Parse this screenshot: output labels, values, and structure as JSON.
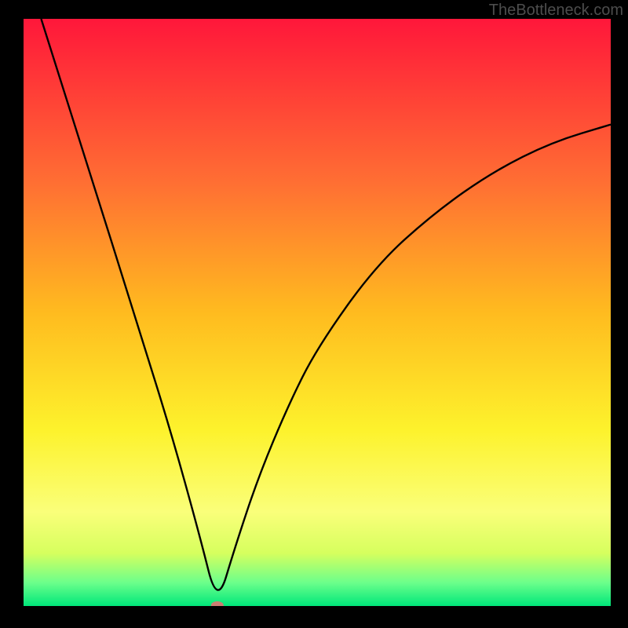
{
  "watermark": "TheBottleneck.com",
  "chart_data": {
    "type": "line",
    "title": "",
    "xlabel": "",
    "ylabel": "",
    "xlim": [
      0,
      100
    ],
    "ylim": [
      0,
      100
    ],
    "grid": false,
    "background_gradient": {
      "stops": [
        {
          "pos": 0,
          "color": "#ff173a"
        },
        {
          "pos": 28,
          "color": "#ff6f33"
        },
        {
          "pos": 50,
          "color": "#ffbb1f"
        },
        {
          "pos": 70,
          "color": "#fdf22c"
        },
        {
          "pos": 84,
          "color": "#faff7a"
        },
        {
          "pos": 91,
          "color": "#d6ff5e"
        },
        {
          "pos": 96,
          "color": "#6cff8b"
        },
        {
          "pos": 100,
          "color": "#00e77a"
        }
      ]
    },
    "curve": {
      "minimum_x": 33,
      "samples": [
        {
          "x": 3,
          "y": 100
        },
        {
          "x": 10,
          "y": 78
        },
        {
          "x": 20,
          "y": 46
        },
        {
          "x": 25,
          "y": 30
        },
        {
          "x": 30,
          "y": 12
        },
        {
          "x": 33,
          "y": 0
        },
        {
          "x": 36,
          "y": 10
        },
        {
          "x": 40,
          "y": 22
        },
        {
          "x": 45,
          "y": 34
        },
        {
          "x": 50,
          "y": 44
        },
        {
          "x": 60,
          "y": 58
        },
        {
          "x": 70,
          "y": 67
        },
        {
          "x": 80,
          "y": 74
        },
        {
          "x": 90,
          "y": 79
        },
        {
          "x": 100,
          "y": 82
        }
      ]
    },
    "marker": {
      "x": 33,
      "y": 0,
      "color": "#cb7e72",
      "rx": 8,
      "ry": 5
    }
  }
}
